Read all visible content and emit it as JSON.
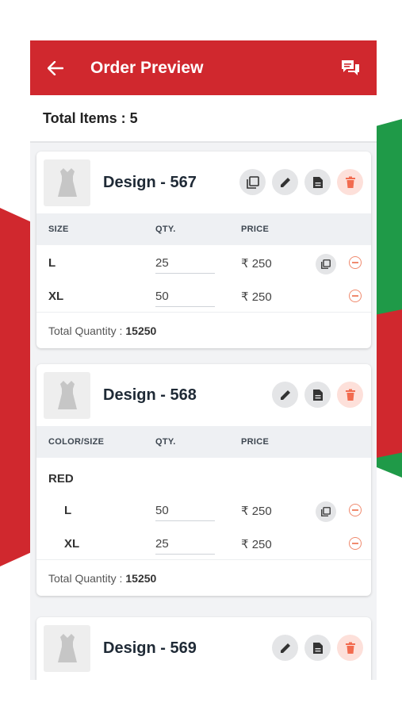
{
  "header": {
    "title": "Order Preview"
  },
  "summary": {
    "total_items_label": "Total Items : 5"
  },
  "table_headers": {
    "size": "SIZE",
    "color_size": "COLOR/SIZE",
    "qty": "QTY.",
    "price": "PRICE"
  },
  "cards": [
    {
      "design": "Design - 567",
      "rows": [
        {
          "size": "L",
          "qty": "25",
          "price": "₹ 250"
        },
        {
          "size": "XL",
          "qty": "50",
          "price": "₹ 250"
        }
      ],
      "total_label": "Total Quantity :",
      "total_value": "15250"
    },
    {
      "design": "Design - 568",
      "color": "RED",
      "rows": [
        {
          "size": "L",
          "qty": "50",
          "price": "₹ 250"
        },
        {
          "size": "XL",
          "qty": "25",
          "price": "₹ 250"
        }
      ],
      "total_label": "Total Quantity :",
      "total_value": "15250"
    },
    {
      "design": "Design - 569"
    }
  ],
  "colors": {
    "primary": "#d0282e",
    "accent_green": "#1f9a48",
    "delete_tint": "#fde0da",
    "delete_icon": "#f26b4f"
  },
  "icons": [
    "back-arrow-icon",
    "chat-icon",
    "copy-icon",
    "edit-icon",
    "document-icon",
    "delete-icon",
    "remove-circle-icon",
    "dress-icon"
  ]
}
